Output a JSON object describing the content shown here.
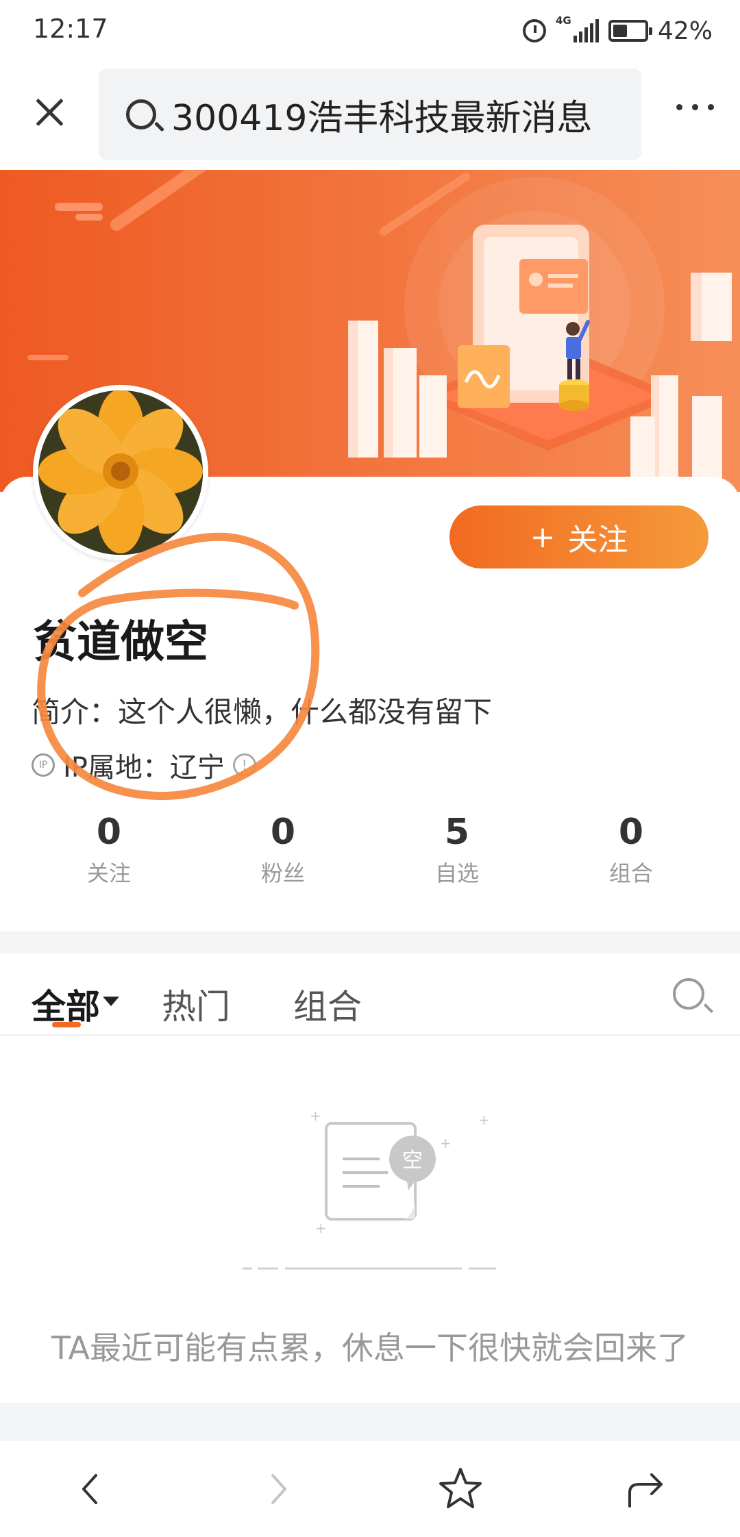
{
  "status_bar": {
    "time": "12:17",
    "network": "4G",
    "battery": "42%"
  },
  "search": {
    "query": "300419浩丰科技最新消息"
  },
  "profile": {
    "name": "贫道做空",
    "follow_label": "关注",
    "follow_plus": "+",
    "bio": "简介：这个人很懒，什么都没有留下",
    "ip_badge": "IP",
    "ip_location": "IP属地：辽宁",
    "info_mark": "!"
  },
  "stats": [
    {
      "value": "0",
      "label": "关注"
    },
    {
      "value": "0",
      "label": "粉丝"
    },
    {
      "value": "5",
      "label": "自选"
    },
    {
      "value": "0",
      "label": "组合"
    }
  ],
  "tabs": [
    {
      "label": "全部"
    },
    {
      "label": "热门"
    },
    {
      "label": "组合"
    }
  ],
  "empty_state": {
    "badge": "空",
    "message": "TA最近可能有点累，休息一下很快就会回来了"
  },
  "colors": {
    "accent": "#f26a21",
    "banner": "#f57c3f",
    "annotation": "#f5893f"
  },
  "icons": {
    "close": "close-icon",
    "search": "search-icon",
    "more": "more-icon",
    "back": "chevron-left-icon",
    "forward": "chevron-right-icon",
    "star": "star-icon",
    "share": "share-icon"
  }
}
